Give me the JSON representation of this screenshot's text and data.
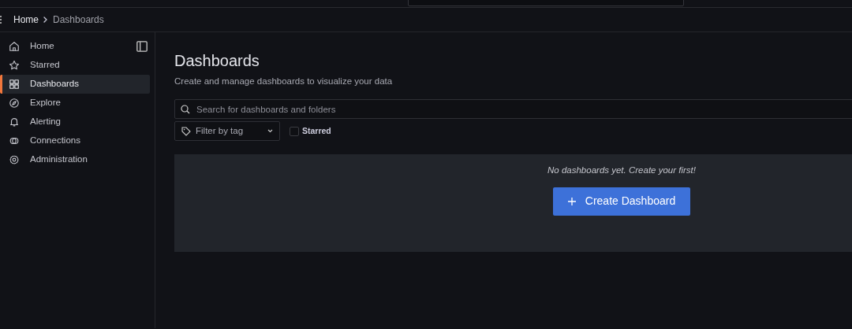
{
  "breadcrumb": [
    {
      "label": "Home",
      "current": false
    },
    {
      "label": "Dashboards",
      "current": true
    }
  ],
  "sidebar": {
    "items": [
      {
        "label": "Home",
        "kind": "home",
        "selected": false
      },
      {
        "label": "Starred",
        "kind": "starred",
        "selected": false
      },
      {
        "label": "Dashboards",
        "kind": "dashboards",
        "selected": true
      },
      {
        "label": "Explore",
        "kind": "explore",
        "selected": false
      },
      {
        "label": "Alerting",
        "kind": "alerting",
        "selected": false
      },
      {
        "label": "Connections",
        "kind": "connections",
        "selected": false
      },
      {
        "label": "Administration",
        "kind": "administration",
        "selected": false
      }
    ]
  },
  "page": {
    "title": "Dashboards",
    "subtitle": "Create and manage dashboards to visualize your data",
    "search": {
      "placeholder": "Search for dashboards and folders"
    },
    "tag_filter": {
      "placeholder": "Filter by tag"
    },
    "starred_filter": {
      "label": "Starred",
      "checked": false
    },
    "empty_state": {
      "message": "No dashboards yet. Create your first!",
      "button": "Create Dashboard"
    }
  }
}
